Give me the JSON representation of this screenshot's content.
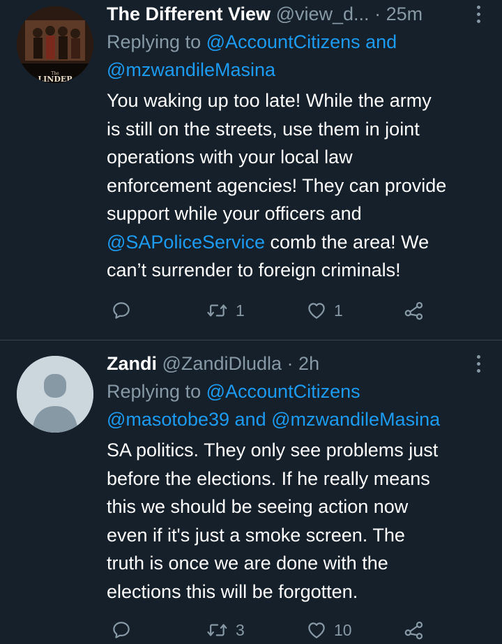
{
  "tweets": [
    {
      "name": "The Different View",
      "handle": "@view_d...",
      "separator": "·",
      "time": "25m",
      "replying_prefix": "Replying to",
      "reply_line1_mention1": "@AccountCitizens",
      "reply_line1_join": "and",
      "reply_line2_mention": "@mzwandileMasina",
      "body_line1": "You waking up too late! While the army",
      "body_line2": "is still on the streets, use them in joint",
      "body_line3": "operations with your local law",
      "body_line4": "enforcement agencies! They can provide",
      "body_line5": "support while your officers and",
      "body_line6_mention": "@SAPoliceService",
      "body_line6_rest": " comb the area! We",
      "body_line7": "can’t surrender to foreign criminals!",
      "retweets": "1",
      "likes": "1",
      "avatar_caption": "The LINDEP"
    },
    {
      "name": "Zandi",
      "handle": "@ZandiDludla",
      "separator": "·",
      "time": "2h",
      "replying_prefix": "Replying to",
      "reply_line1_mention1": "@AccountCitizens",
      "reply_line2_mention1": "@masotobe39",
      "reply_line2_join": "and",
      "reply_line2_mention2": "@mzwandileMasina",
      "body_line1": "SA politics. They only see problems just",
      "body_line2": "before the elections.  If he really means",
      "body_line3": "this we should be seeing action now",
      "body_line4": "even if it's just a smoke screen. The",
      "body_line5": "truth is once we are done with the",
      "body_line6": "elections this will be forgotten.",
      "retweets": "3",
      "likes": "10"
    }
  ],
  "colors": {
    "background": "#15202b",
    "text_primary": "#ffffff",
    "text_secondary": "#8899a6",
    "link": "#1d9bf0",
    "divider": "#38444d"
  },
  "icons": [
    "reply-icon",
    "retweet-icon",
    "like-icon",
    "share-icon",
    "more-icon"
  ]
}
